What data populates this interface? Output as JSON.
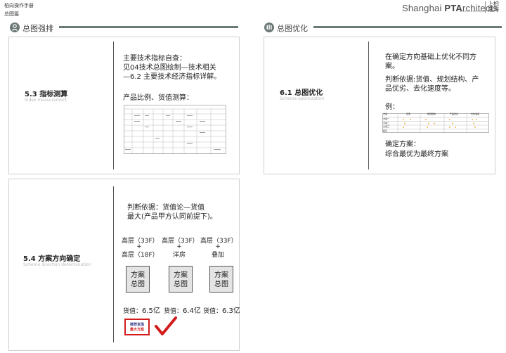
{
  "header": {
    "manual_title": "柏向操作手册",
    "section_name": "总图篇",
    "logo_text_a": "Shanghai ",
    "logo_text_b": "PTA",
    "logo_text_c": "rchitects",
    "logo_sub": "www.ptashanghai.com",
    "logo_cn_top": "上柏",
    "logo_cn_bottom": "南海"
  },
  "sections": {
    "left_title": "总图强排",
    "right_title": "总图优化"
  },
  "card_53": {
    "number_title": "5.3  指标测算",
    "subtitle": "Index measurement",
    "text_1": "主要技术指标自查：",
    "text_2": "见04技术总图绘制—技术相关",
    "text_3": "—6.2 主要技术经济指标详解。",
    "text_4": "产品比例、货值测算："
  },
  "card_54": {
    "number_title": "5.4  方案方向确定",
    "subtitle": "Scheme direction determination",
    "text_1": "判断依据：货值论—货值",
    "text_2": "最大(产品甲方认同前提下)。",
    "options": [
      {
        "line1": "高层（33F）",
        "plus": "+",
        "line2": "高层（18F）",
        "box_top": "方案",
        "box_bottom": "总图",
        "value_prefix": "货值：",
        "value": "6.5亿"
      },
      {
        "line1": "高层（33F）",
        "plus": "+",
        "line2": "洋房",
        "box_top": "方案",
        "box_bottom": "总图",
        "value_prefix": "货值：",
        "value": "6.4亿"
      },
      {
        "line1": "高层（33F）",
        "plus": "+",
        "line2": "叠加",
        "box_top": "方案",
        "box_bottom": "总图",
        "value_prefix": "货值：",
        "value": "6.3亿"
      }
    ],
    "stamp_line1": "推荐货值",
    "stamp_line2": "最大方案"
  },
  "card_61": {
    "number_title": "6.1  总图优化",
    "subtitle": "Scheme optimization",
    "text_1": "在确定方向基础上优化不同方",
    "text_2": "案。",
    "text_3": "判断依据:货值、规划结构、产",
    "text_4": "品优劣、去化速度等。",
    "example_label": "例：",
    "table_headers": [
      "方案",
      "货值",
      "规划结构",
      "产品优劣",
      "去化速度"
    ],
    "table_rows": [
      "方案一",
      "方案二",
      "方案三",
      "结论"
    ],
    "text_5": "确定方案：",
    "text_6": "综合最优为最终方案"
  },
  "colors": {
    "accent_gray": "#6c7a77",
    "stamp_red": "#d21c1c",
    "star_yellow": "#e8a31c"
  }
}
